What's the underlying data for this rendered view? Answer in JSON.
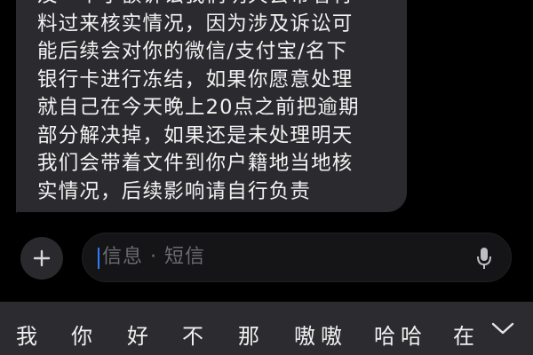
{
  "message": {
    "lines": [
      "及一个小额诉讼我们明天会带着材",
      "料过来核实情况，因为涉及诉讼可",
      "能后续会对你的微信/支付宝/名下",
      "银行卡进行冻结，如果你愿意处理",
      "就自己在今天晚上20点之前把逾期",
      "部分解决掉，如果还是未处理明天",
      "我们会带着文件到你户籍地当地核",
      "实情况，后续影响请自行负责"
    ]
  },
  "input": {
    "placeholder": "信息 · 短信",
    "add_icon": "plus-icon",
    "mic_icon": "microphone-icon"
  },
  "candidates": {
    "items": [
      "我",
      "你",
      "好",
      "不",
      "那",
      "嗷嗷",
      "哈哈",
      "在"
    ],
    "expand_icon": "chevron-down-icon"
  },
  "colors": {
    "background": "#000000",
    "bubble": "#2b2b2f",
    "caret": "#2f7cf6",
    "candidate_bar": "#2c2c30"
  }
}
